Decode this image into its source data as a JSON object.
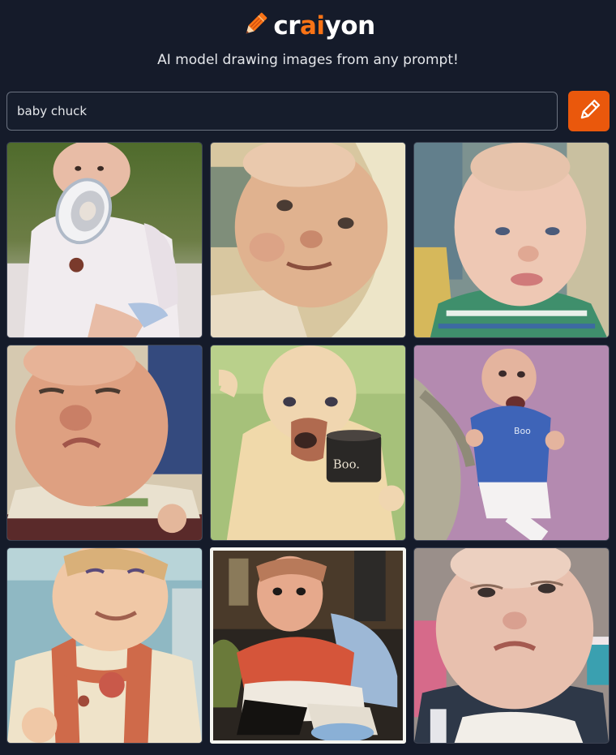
{
  "brand": {
    "name_prefix": "cr",
    "name_accent": "ai",
    "name_suffix": "yon",
    "accent_color": "#f97316"
  },
  "tagline": "AI model drawing images from any prompt!",
  "search": {
    "value": "baby chuck",
    "placeholder": ""
  },
  "draw_button": {
    "icon": "pencil-icon",
    "color": "#ea580c"
  },
  "images": [
    {
      "name": "result-image-1",
      "caption": ""
    },
    {
      "name": "result-image-2",
      "caption": ""
    },
    {
      "name": "result-image-3",
      "caption": ""
    },
    {
      "name": "result-image-4",
      "caption": ""
    },
    {
      "name": "result-image-5",
      "caption": "Boo."
    },
    {
      "name": "result-image-6",
      "caption": "Boo"
    },
    {
      "name": "result-image-7",
      "caption": ""
    },
    {
      "name": "result-image-8",
      "caption": ""
    },
    {
      "name": "result-image-9",
      "caption": ""
    }
  ]
}
